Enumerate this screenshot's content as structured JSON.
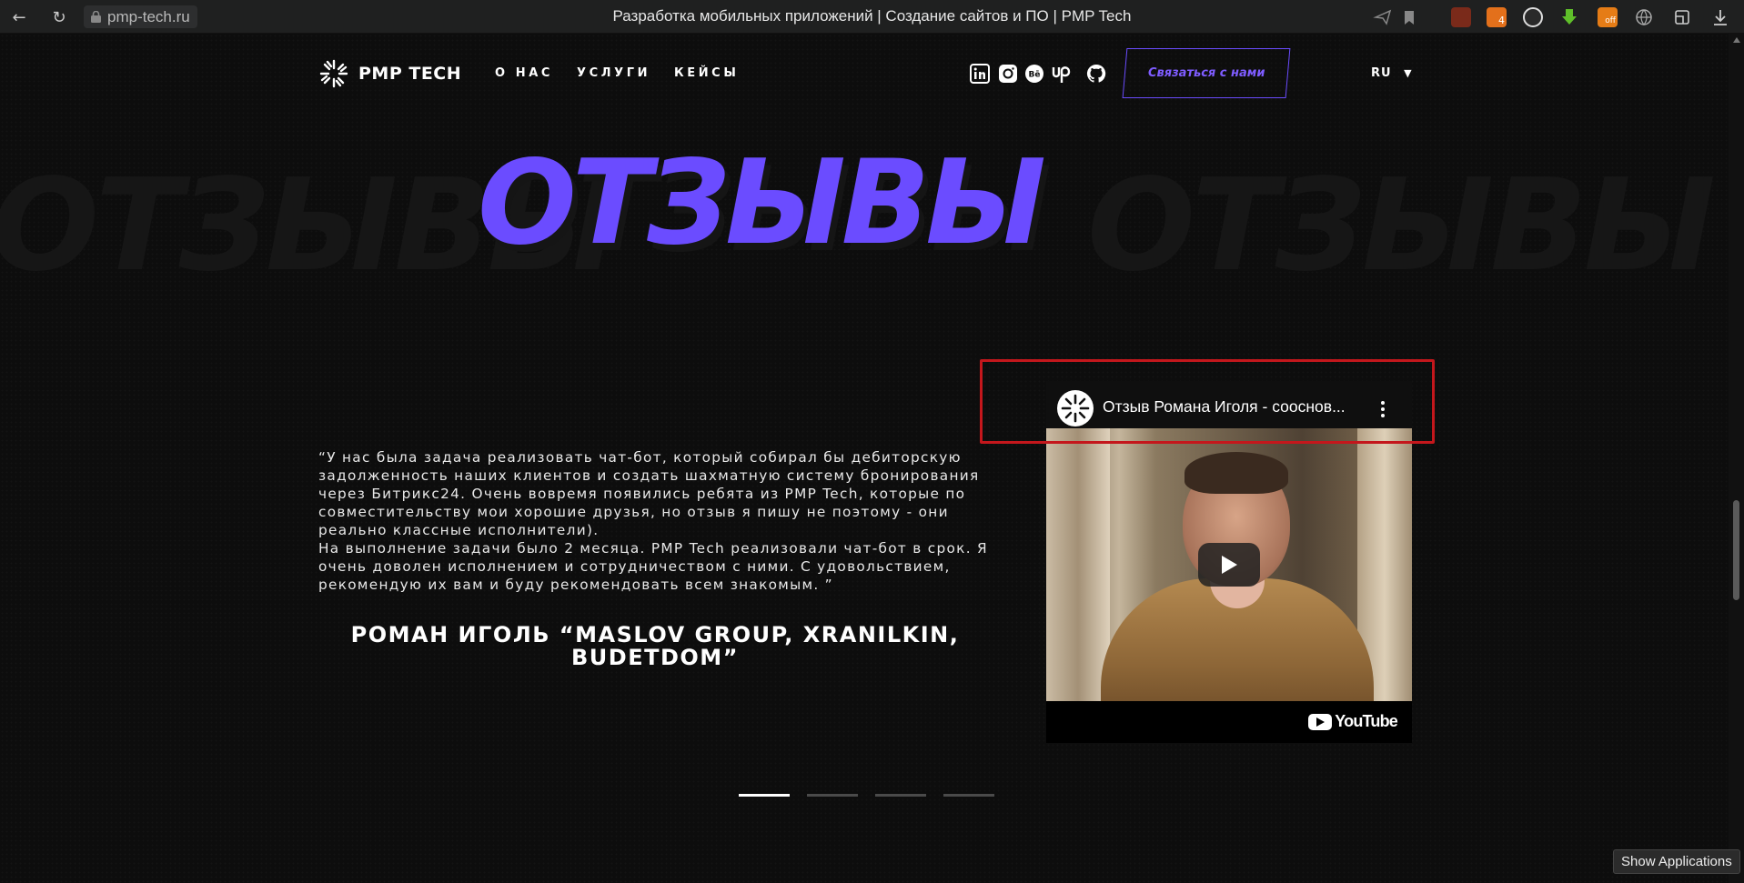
{
  "browser": {
    "url": "pmp-tech.ru",
    "title": "Разработка мобильных приложений | Создание сайтов и ПО | PMP Tech",
    "extension_badge": "4",
    "extension_off_label": "off"
  },
  "nav": {
    "brand": "PMP TECH",
    "links": [
      "О НАС",
      "УСЛУГИ",
      "КЕЙСЫ"
    ],
    "social_icons": [
      "linkedin-icon",
      "instagram-icon",
      "behance-icon",
      "upwork-icon",
      "github-icon"
    ],
    "contact_label": "Связаться с нами",
    "language": "RU"
  },
  "section": {
    "heading": "ОТЗЫВЫ",
    "ghost_text": "ОТЗЫВЫ"
  },
  "testimonial": {
    "quote_p1": "“У нас была задача реализовать чат-бот, который собирал бы дебиторскую задолженность наших клиентов и создать шахматную систему бронирования через Битрикс24. Очень вовремя появились ребята из PMP Tech, которые по совместительству мои хорошие друзья, но отзыв я пишу не поэтому - они реально классные исполнители).",
    "quote_p2": "На выполнение задачи было 2 месяца. PMP Tech реализовали чат-бот в срок. Я очень доволен исполнением и сотрудничеством с ними. С удовольствием, рекомендую их вам и буду рекомендовать всем знакомым. ”",
    "author": "РОМАН ИГОЛЬ “MASLOV GROUP, XRANILKIN, BUDETDOM”"
  },
  "video": {
    "title": "Отзыв Романа Иголя - сооснов...",
    "platform": "YouTube"
  },
  "slider": {
    "total": 4,
    "active_index": 0
  },
  "os": {
    "tooltip": "Show Applications"
  },
  "colors": {
    "accent": "#6b4cff",
    "background": "#0d0d0d",
    "highlight": "#c4171c"
  }
}
